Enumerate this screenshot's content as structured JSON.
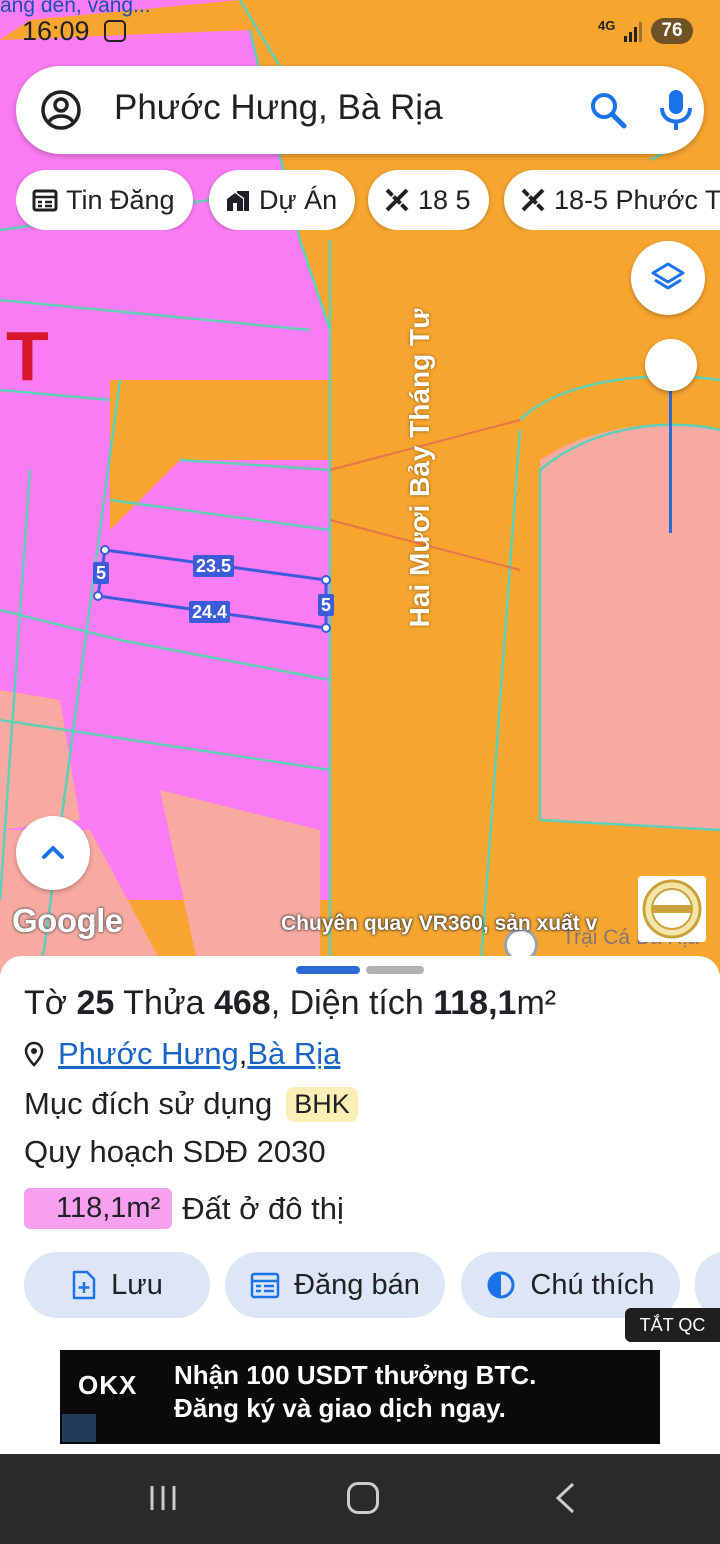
{
  "status_bar": {
    "snippet": "ang đến, vàng...",
    "time": "16:09",
    "network": "4G",
    "battery": "76"
  },
  "search": {
    "query": "Phước Hưng, Bà Rịa",
    "icons": [
      "account-circle-icon",
      "search-icon",
      "mic-icon"
    ]
  },
  "chips": [
    {
      "label": "Tin Đăng",
      "icon": "calendar-list-icon"
    },
    {
      "label": "Dự Án",
      "icon": "buildings-icon"
    },
    {
      "label": "18 5",
      "icon": "ruler-cross-icon"
    },
    {
      "label": "18-5 Phước T",
      "icon": "ruler-cross-icon"
    }
  ],
  "map": {
    "road_label": "Hai Mươi Bảy Tháng Tư",
    "red_mark": "T",
    "google": "Google",
    "caption": "Chuyên quay VR360, sản xuất v",
    "faint_place": "Trại Cá Bà Rịa",
    "dimensions": {
      "top": "23.5",
      "bottom": "24.4",
      "left": "5",
      "right": "5"
    },
    "colors": {
      "commercial_orange": "#f7a52f",
      "residential_pink": "#f97cf2",
      "salmon": "#f8aaa0",
      "parcel_line": "#5fd0b8",
      "measure_blue": "#3b5bd9"
    }
  },
  "sheet": {
    "title_parts": {
      "to_label": "Tờ ",
      "to_value": "25",
      "thua_label": " Thửa ",
      "thua_value": "468",
      "area_label": ", Diện tích ",
      "area_value": "118,1",
      "area_unit": "m²"
    },
    "location": {
      "ward": "Phước Hưng",
      "separator": ", ",
      "city": "Bà Rịa"
    },
    "purpose_label": "Mục đích sử dụng",
    "purpose_code": "BHK",
    "plan_label": "Quy hoạch SDĐ 2030",
    "area_chip": "118,1m²",
    "area_type": "Đất ở đô thị",
    "actions": [
      {
        "label": "Lưu",
        "icon": "add-file-icon"
      },
      {
        "label": "Đăng bán",
        "icon": "calendar-list-icon"
      },
      {
        "label": "Chú thích",
        "icon": "half-circle-icon"
      }
    ]
  },
  "ad": {
    "close_label": "TẮT QC",
    "brand": "OKX",
    "line1": "Nhận 100 USDT thưởng BTC.",
    "line2": "Đăng ký và giao dịch ngay."
  }
}
